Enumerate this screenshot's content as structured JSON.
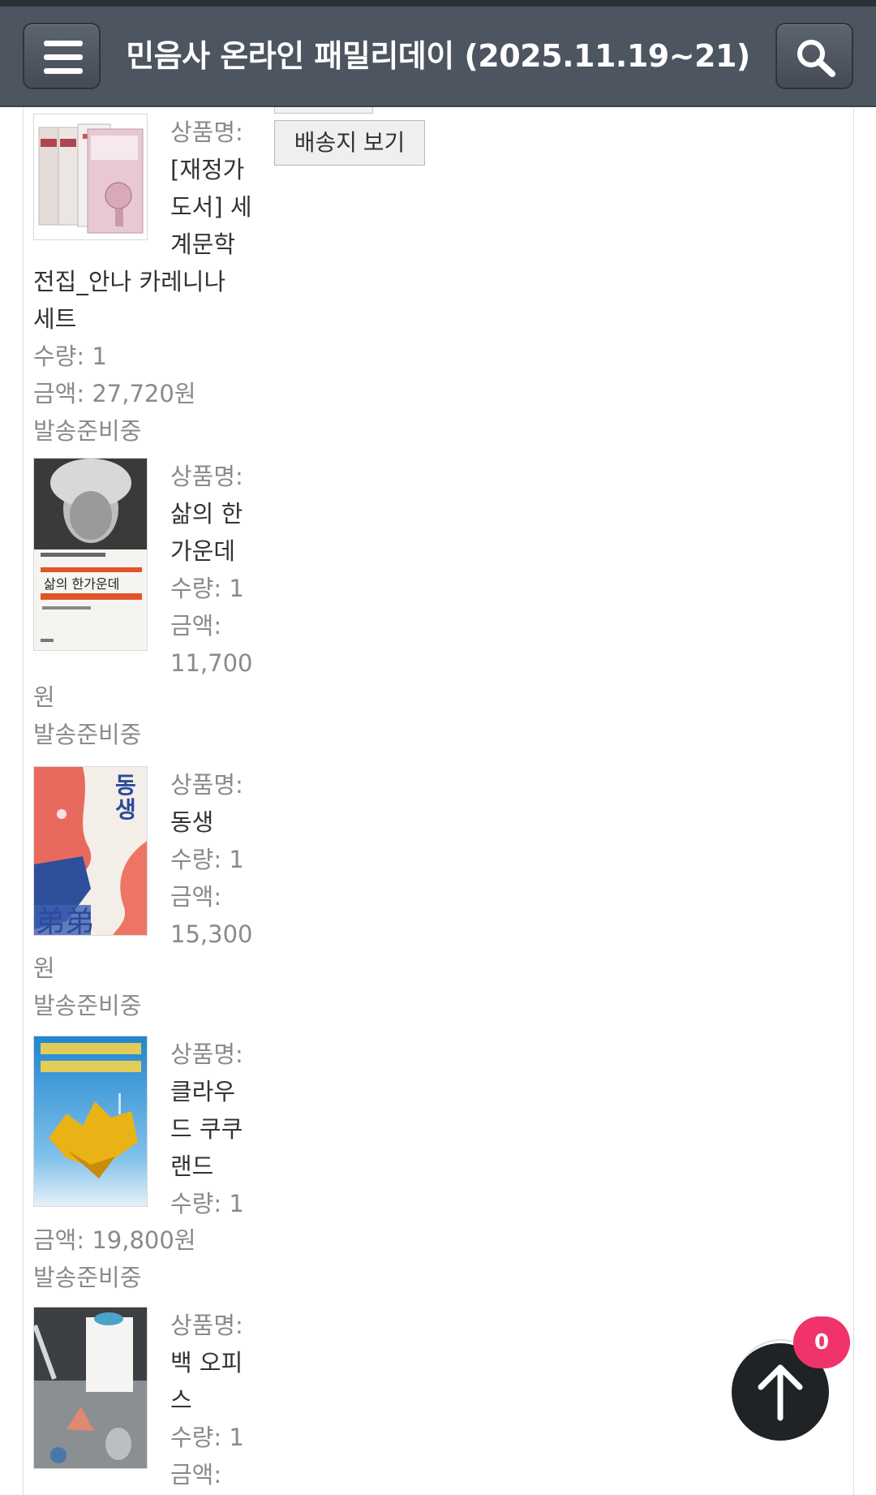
{
  "header": {
    "title": "민음사 온라인 패밀리데이 (2025.11.19~21)",
    "menu_icon": "hamburger-menu-icon",
    "search_icon": "search-icon"
  },
  "actions": {
    "view_shipping_label": "배송지 보기"
  },
  "labels": {
    "product_name": "상품명:",
    "quantity": "수량:",
    "amount": "금액:"
  },
  "orders": [
    {
      "name_lines": [
        "[재정가",
        "도서] 세",
        "계문학"
      ],
      "name_full_lines": [
        "전집_안나 카레니나",
        "세트"
      ],
      "quantity": "1",
      "amount": "27,720원",
      "status": "발송준비중"
    },
    {
      "name_lines": [
        "삶의 한",
        "가운데"
      ],
      "quantity": "1",
      "amount_value": "11,700",
      "amount_unit": "원",
      "status": "발송준비중"
    },
    {
      "name_lines": [
        "동생"
      ],
      "quantity": "1",
      "amount_value": "15,300",
      "amount_unit": "원",
      "status": "발송준비중"
    },
    {
      "name_lines": [
        "클라우",
        "드 쿠쿠",
        "랜드"
      ],
      "quantity": "1",
      "amount": "19,800원",
      "status": "발송준비중"
    },
    {
      "name_lines": [
        "백 오피",
        "스"
      ],
      "quantity": "1"
    }
  ],
  "floating": {
    "cart_count": "0",
    "scroll_top_icon": "arrow-up-icon"
  },
  "colors": {
    "header_bg": "#4d5561",
    "badge": "#f0336a",
    "label_gray": "#8a8a8a"
  }
}
